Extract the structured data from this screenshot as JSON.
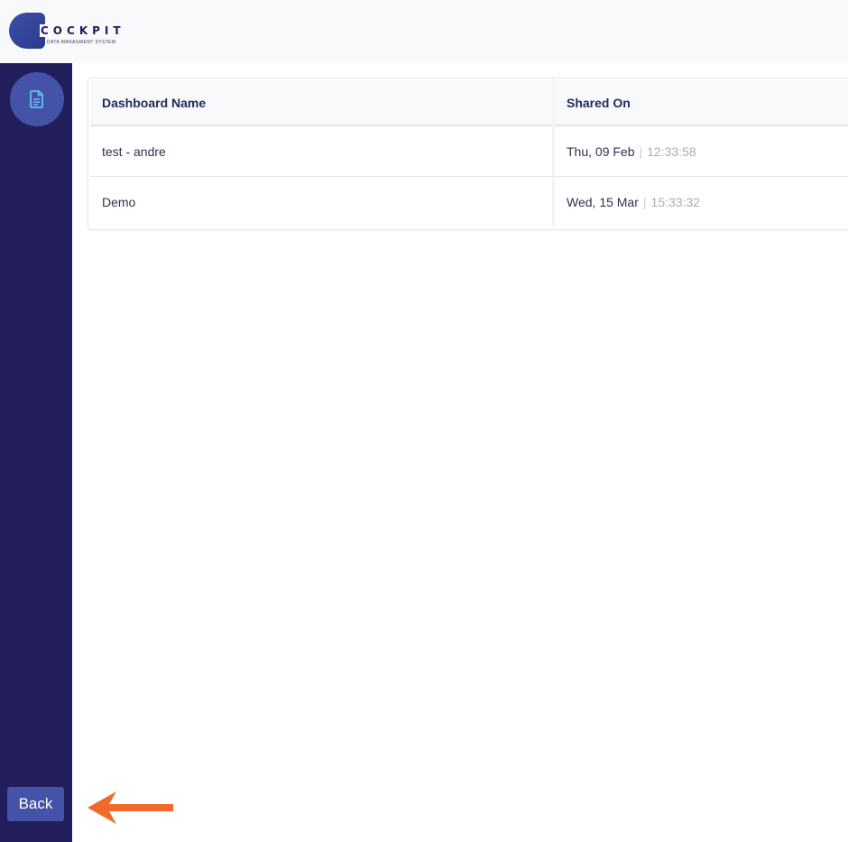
{
  "brand": {
    "title": "COCKPIT",
    "subtitle": "DATA MANAGMENT SYSTEM"
  },
  "sidebar": {
    "nav_icon": "document-icon",
    "back_label": "Back"
  },
  "table": {
    "headers": {
      "name": "Dashboard Name",
      "shared_on": "Shared On"
    },
    "rows": [
      {
        "name": "test - andre",
        "date": "Thu, 09 Feb",
        "time": "12:33:58"
      },
      {
        "name": "Demo",
        "date": "Wed, 15 Mar",
        "time": "15:33:32"
      }
    ],
    "separator": "|"
  },
  "colors": {
    "sidebar": "#221e5c",
    "accent": "#4452a8",
    "icon": "#5fc4f0",
    "annotation_arrow": "#f26a2a"
  }
}
